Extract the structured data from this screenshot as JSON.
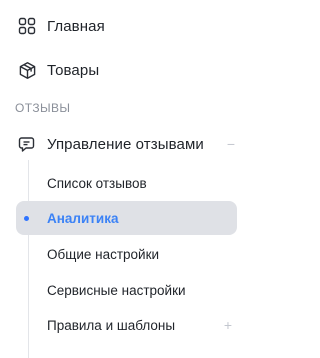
{
  "nav": {
    "items": [
      {
        "label": "Главная",
        "icon": "grid-icon"
      },
      {
        "label": "Товары",
        "icon": "box-icon"
      }
    ],
    "section_title": "ОТЗЫВЫ",
    "group": {
      "label": "Управление отзывами",
      "icon": "chat-icon",
      "toggle": "−",
      "children": [
        {
          "label": "Список отзывов"
        },
        {
          "label": "Аналитика",
          "active": true
        },
        {
          "label": "Общие настройки"
        },
        {
          "label": "Сервисные настройки"
        },
        {
          "label": "Правила и шаблоны",
          "toggle": "+"
        }
      ]
    },
    "colors": {
      "active_text": "#3b82f6",
      "active_bg": "#dfe1e6",
      "dot": "#2f74ff"
    }
  }
}
